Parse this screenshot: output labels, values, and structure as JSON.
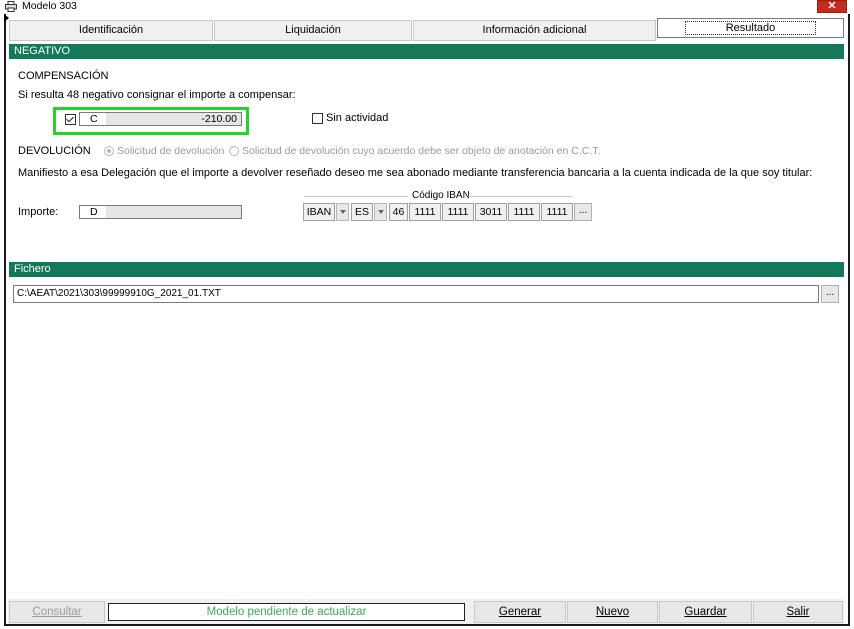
{
  "window": {
    "title": "Modelo 303",
    "close_glyph": "✕"
  },
  "tabs": [
    {
      "label": "Identificación"
    },
    {
      "label": "Liquidación"
    },
    {
      "label": "Información adicional"
    },
    {
      "label": "Resultado",
      "active": true
    }
  ],
  "negativo": {
    "header": "NEGATIVO",
    "compensacion_label": "COMPENSACIÓN",
    "compensacion_text": "Si resulta 48 negativo consignar el importe a compensar:",
    "compensar_checked": true,
    "compensar_prefix": "C",
    "compensar_value": "-210.00",
    "sin_actividad_label": "Sin actividad",
    "sin_actividad_checked": false,
    "devolucion_label": "DEVOLUCIÓN",
    "radio_1_label": "Solicitud de devolución",
    "radio_2_label": "Solicitud de devolución cuyo acuerdo debe ser objeto de anotación en C.C.T.",
    "manifiesto_text": "Manifiesto a esa Delegación que el importe a devolver reseñado deseo me sea abonado mediante transferencia bancaria a la cuenta indicada de la que soy titular:",
    "importe_label": "Importe:",
    "importe_prefix": "D",
    "importe_value": "",
    "iban_legend": "Código IBAN",
    "iban": {
      "type": "IBAN",
      "country": "ES",
      "check": "46",
      "blocks": [
        "1111",
        "1111",
        "3011",
        "1111",
        "1111"
      ],
      "more_label": "..."
    }
  },
  "fichero": {
    "header": "Fichero",
    "path": "C:\\AEAT\\2021\\303\\99999910G_2021_01.TXT",
    "browse_label": "..."
  },
  "footer": {
    "consultar_label": "Consultar",
    "status_text": "Modelo pendiente de actualizar",
    "generar_label": "Generar",
    "nuevo_label": "Nuevo",
    "guardar_label": "Guardar",
    "salir_label": "Salir"
  },
  "colors": {
    "section_green": "#14785a",
    "highlight_green": "#28d22b",
    "status_text_green": "#3da85c",
    "close_red": "#c42b1c"
  }
}
